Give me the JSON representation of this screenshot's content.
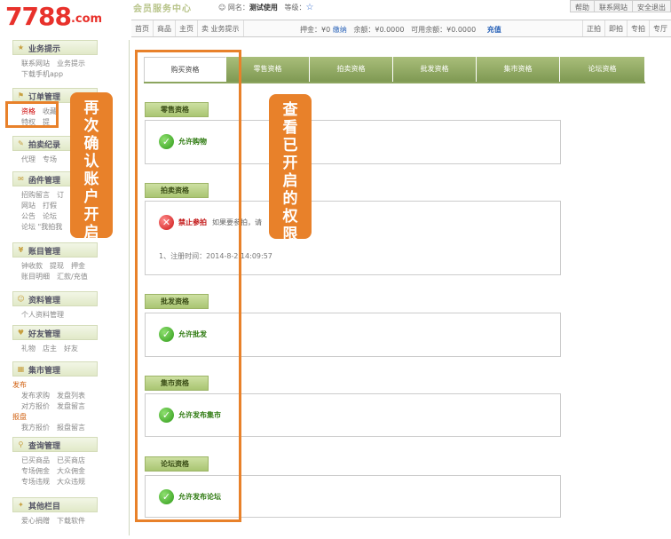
{
  "header": {
    "logo_text": "7788",
    "logo_suffix": ".com",
    "member_center": "会员服务中心",
    "username_label": "网名：",
    "username": "测试使用",
    "level_label": "等级：",
    "top_links": [
      "帮助",
      "联系网站",
      "安全退出"
    ]
  },
  "nav": {
    "items": [
      "首页",
      "商品",
      "主页",
      "卖 业务提示"
    ],
    "deposit_label": "押金：¥0",
    "deposit_link": "缴纳",
    "balance": "余额：¥0.0000",
    "available": "可用余额：¥0.0000",
    "recharge": "充值",
    "right_items": [
      "正拍",
      "即拍",
      "专拍",
      "专厅"
    ]
  },
  "sidebar": {
    "sections": [
      {
        "title": "业务提示",
        "rows": [
          [
            "联系网站",
            "业务提示"
          ],
          [
            "下载手机app"
          ]
        ]
      },
      {
        "title": "订单管理",
        "rows": [
          [
            "资格",
            "收藏"
          ],
          [
            "特权",
            "提"
          ]
        ]
      },
      {
        "title": "拍卖纪录",
        "rows": [
          [
            "代理",
            "专场"
          ]
        ]
      },
      {
        "title": "函件管理",
        "rows": [
          [
            "招购留言",
            "订"
          ],
          [
            "网站",
            "打假"
          ],
          [
            "公告",
            "论坛"
          ],
          [
            "论坛 \"我拍我"
          ]
        ]
      },
      {
        "title": "账目管理",
        "rows": [
          [
            "钟收款",
            "提现",
            "押金"
          ],
          [
            "账目明细",
            "汇款/充值"
          ]
        ]
      },
      {
        "title": "资料管理",
        "rows": [
          [
            "个人资料管理"
          ]
        ]
      },
      {
        "title": "好友管理",
        "rows": [
          [
            "礼物",
            "店主",
            "好友"
          ]
        ]
      },
      {
        "title": "集市管理",
        "rows": [
          [
            "发布"
          ],
          [
            "发布求购",
            "发盘列表"
          ],
          [
            "对方报价",
            "发盘留言"
          ],
          [
            "报盘"
          ],
          [
            "我方报价",
            "报盘留言"
          ]
        ]
      },
      {
        "title": "查询管理",
        "rows": [
          [
            "已买商品",
            "已买商店"
          ],
          [
            "专场佣金",
            "大众佣金"
          ],
          [
            "专场违规",
            "大众违规"
          ]
        ]
      },
      {
        "title": "其他栏目",
        "rows": [
          [
            "爱心捐赠",
            "下载软件"
          ]
        ]
      }
    ]
  },
  "tabs": [
    "购买资格",
    "零售资格",
    "拍卖资格",
    "批发资格",
    "集市资格",
    "论坛资格"
  ],
  "sections": {
    "retail": {
      "label": "零售资格",
      "status": "允许购物"
    },
    "auction": {
      "label": "拍卖资格",
      "status": "禁止参拍",
      "note": "如果要参拍，请",
      "reg_time": "1、注册时间：2014-8-2 14:09:57"
    },
    "wholesale": {
      "label": "批发资格",
      "status": "允许批发"
    },
    "market": {
      "label": "集市资格",
      "status": "允许发布集市"
    },
    "forum": {
      "label": "论坛资格",
      "status": "允许发布论坛"
    }
  },
  "annotations": {
    "left": "再次确认账户开启",
    "right": "查看已开启的权限"
  },
  "colors": {
    "accent": "#e8812a",
    "tab_green": "#8ca55f",
    "ok_green": "#2e7a10"
  }
}
